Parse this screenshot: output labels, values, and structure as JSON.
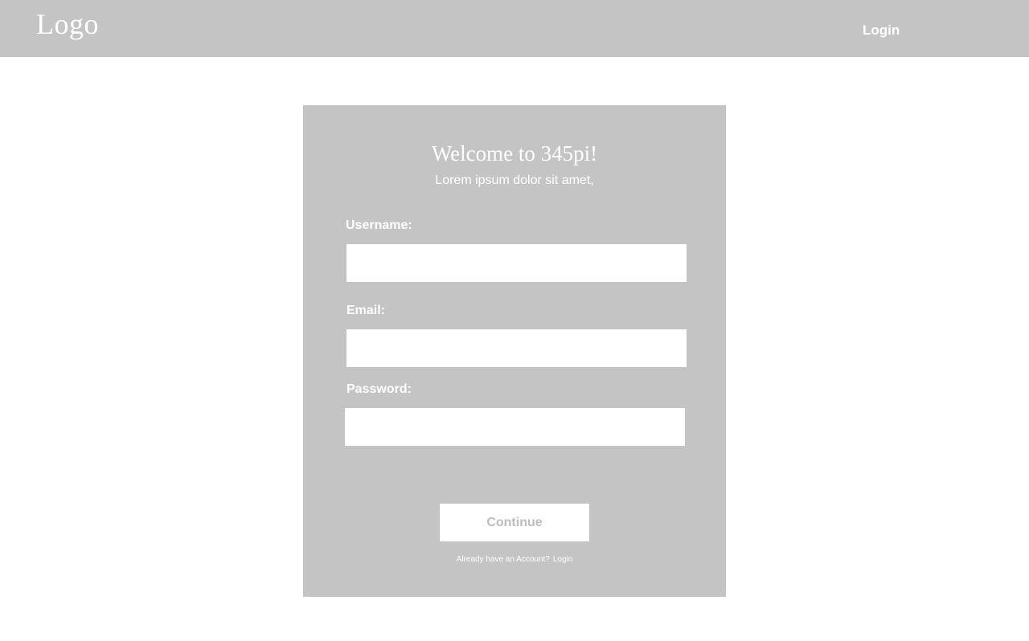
{
  "header": {
    "logo": "Logo",
    "login_link": "Login"
  },
  "form": {
    "title": "Welcome to 345pi!",
    "subtitle": "Lorem ipsum dolor sit amet,",
    "username_label": "Username:",
    "username_value": "",
    "email_label": "Email:",
    "email_value": "",
    "password_label": "Password:",
    "password_value": "",
    "continue_label": "Continue",
    "account_prompt": "Already have an Account?",
    "login_link": "Login"
  },
  "colors": {
    "panel": "#c4c4c4",
    "text": "#ffffff",
    "button_text": "#bdbdbd"
  }
}
